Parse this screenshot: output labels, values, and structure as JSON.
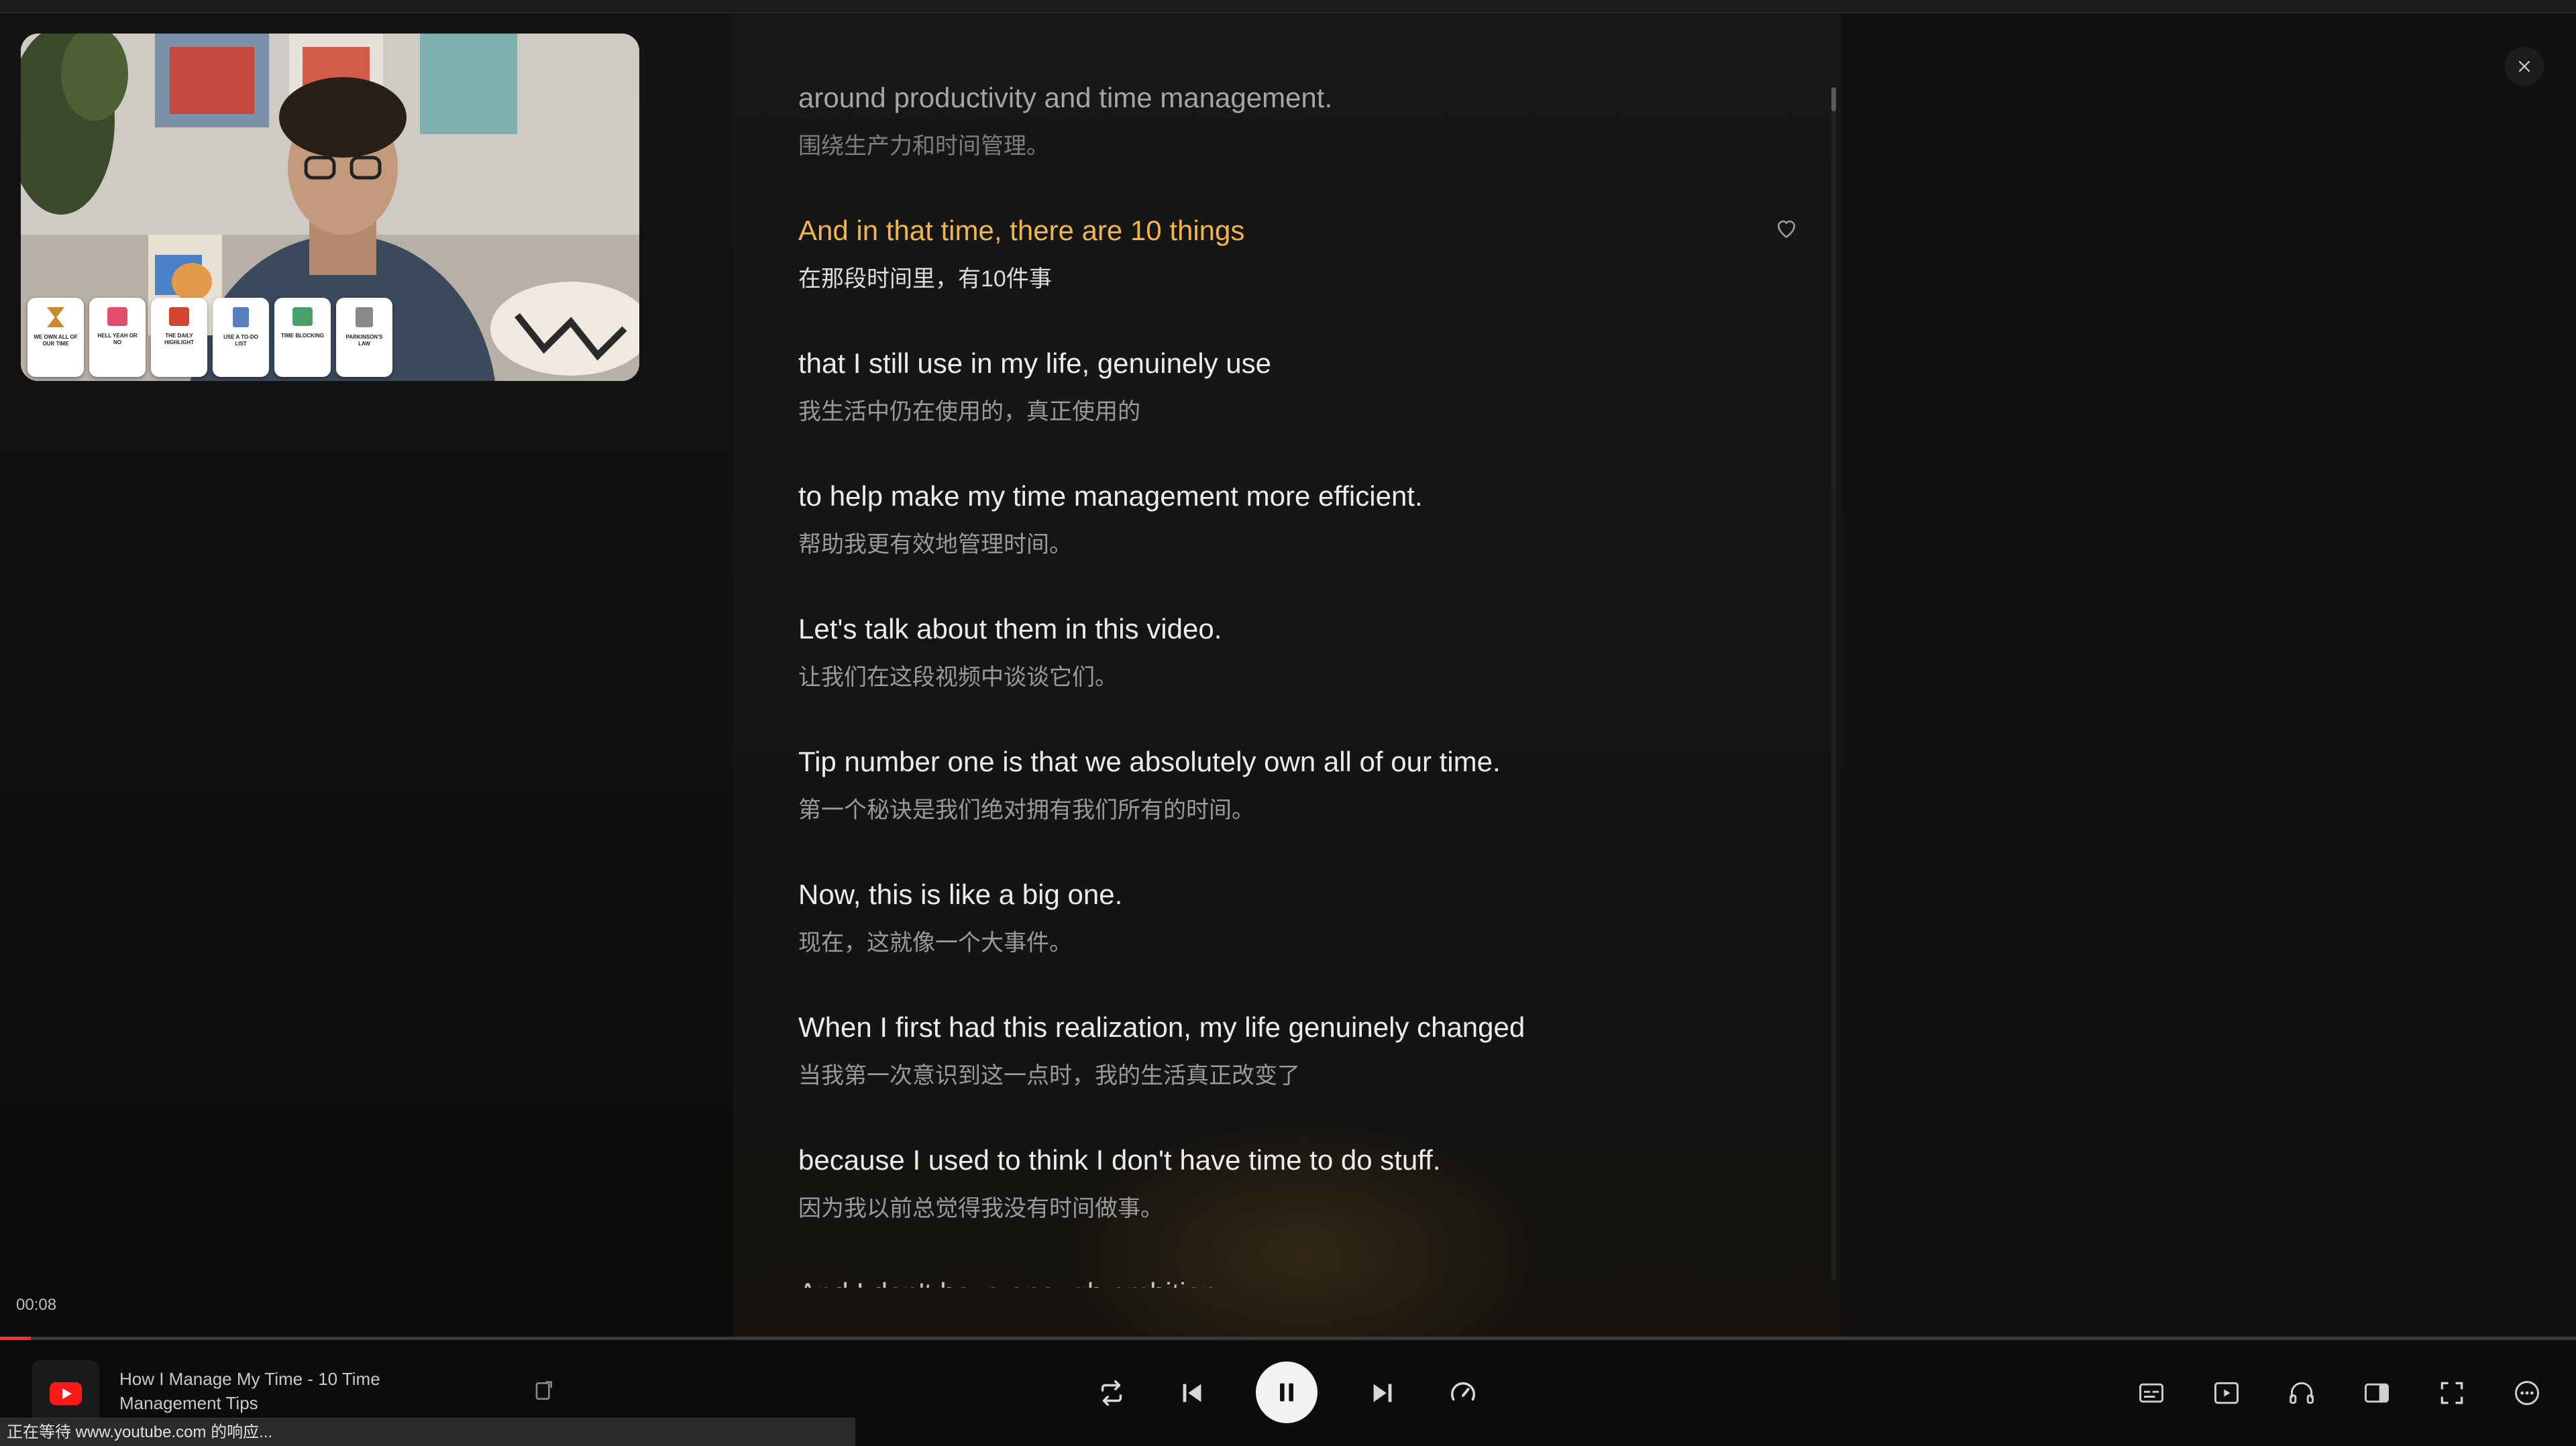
{
  "player": {
    "current_time": "00:08",
    "progress_fraction": 0.012
  },
  "transcript": {
    "lines": [
      {
        "en": "around productivity and time management.",
        "zh": "围绕生产力和时间管理。",
        "state": "faded"
      },
      {
        "en": "And in that time, there are 10 things",
        "zh": "在那段时间里，有10件事",
        "state": "active"
      },
      {
        "en": "that I still use in my life, genuinely use",
        "zh": "我生活中仍在使用的，真正使用的",
        "state": "normal"
      },
      {
        "en": "to help make my time management more efficient.",
        "zh": "帮助我更有效地管理时间。",
        "state": "normal"
      },
      {
        "en": "Let's talk about them in this video.",
        "zh": "让我们在这段视频中谈谈它们。",
        "state": "normal"
      },
      {
        "en": "Tip number one is that we absolutely own all of our time.",
        "zh": "第一个秘诀是我们绝对拥有我们所有的时间。",
        "state": "normal"
      },
      {
        "en": "Now, this is like a big one.",
        "zh": "现在，这就像一个大事件。",
        "state": "normal"
      },
      {
        "en": "When I first had this realization, my life genuinely changed",
        "zh": "当我第一次意识到这一点时，我的生活真正改变了",
        "state": "normal"
      },
      {
        "en": "because I used to think I don't have time to do stuff.",
        "zh": "因为我以前总觉得我没有时间做事。",
        "state": "normal"
      }
    ],
    "partial_line": "And I don't have enough ambition"
  },
  "video": {
    "title": "How I Manage My Time - 10 Time Management Tips",
    "thumbnail_cards": [
      "WE OWN ALL OF OUR TIME",
      "HELL YEAH OR NO",
      "THE DAILY HIGHLIGHT",
      "USE A TO-DO LIST",
      "TIME BLOCKING",
      "PARKINSON'S LAW"
    ]
  },
  "status": {
    "text": "正在等待 www.youtube.com 的响应..."
  },
  "colors": {
    "active_line": "#f2b54a",
    "progress": "#ff2d2d",
    "youtube_red": "#ff1a1a"
  },
  "icons": {
    "close": "close-icon",
    "heart": "heart-icon",
    "repeat": "repeat-icon",
    "previous": "skip-previous-icon",
    "pause": "pause-icon",
    "next": "skip-next-icon",
    "speed": "speed-icon",
    "subtitles": "subtitles-icon",
    "video": "video-icon",
    "audio": "headphones-icon",
    "sidebar": "sidebar-icon",
    "fullscreen": "fullscreen-icon",
    "more": "more-icon"
  }
}
